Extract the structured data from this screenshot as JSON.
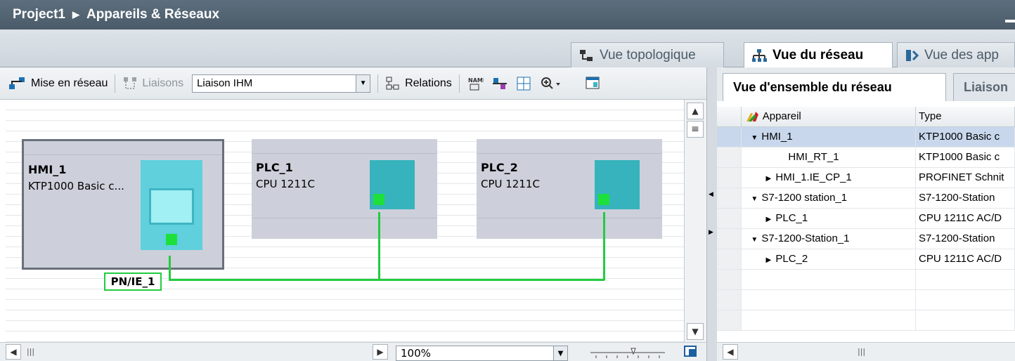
{
  "breadcrumb": {
    "project": "Project1",
    "separator": "▶",
    "section": "Appareils & Réseaux"
  },
  "view_tabs": [
    {
      "label": "Vue topologique",
      "icon": "topology-icon",
      "active": false
    },
    {
      "label": "Vue du réseau",
      "icon": "network-icon",
      "active": true
    },
    {
      "label": "Vue des app",
      "icon": "device-view-icon",
      "active": false
    }
  ],
  "toolbar": {
    "network_label": "Mise en réseau",
    "connections_label": "Liaisons",
    "connection_type": "Liaison IHM",
    "relations_label": "Relations"
  },
  "devices": [
    {
      "name": "HMI_1",
      "model": "KTP1000 Basic c...",
      "selected": true
    },
    {
      "name": "PLC_1",
      "model": "CPU 1211C",
      "selected": false
    },
    {
      "name": "PLC_2",
      "model": "CPU 1211C",
      "selected": false
    }
  ],
  "subnet": {
    "label": "PN/IE_1",
    "color": "#22cc40"
  },
  "zoom": {
    "value": "100%"
  },
  "overview": {
    "tabs": [
      {
        "label": "Vue d'ensemble du réseau",
        "active": true
      },
      {
        "label": "Liaison",
        "active": false
      }
    ],
    "columns": {
      "device": "Appareil",
      "type": "Type"
    },
    "rows": [
      {
        "indent": 1,
        "toggle": "▼",
        "device": "HMI_1",
        "type": "KTP1000 Basic c",
        "selected": true
      },
      {
        "indent": 2,
        "toggle": "",
        "device": "HMI_RT_1",
        "type": "KTP1000 Basic c",
        "selected": false
      },
      {
        "indent": 2,
        "toggle": "▶",
        "device": "HMI_1.IE_CP_1",
        "type": "PROFINET Schnit",
        "selected": false
      },
      {
        "indent": 1,
        "toggle": "▼",
        "device": "S7-1200 station_1",
        "type": "S7-1200-Station",
        "selected": false
      },
      {
        "indent": 2,
        "toggle": "▶",
        "device": "PLC_1",
        "type": "CPU 1211C AC/D",
        "selected": false
      },
      {
        "indent": 1,
        "toggle": "▼",
        "device": "S7-1200-Station_1",
        "type": "S7-1200-Station",
        "selected": false
      },
      {
        "indent": 2,
        "toggle": "▶",
        "device": "PLC_2",
        "type": "CPU 1211C AC/D",
        "selected": false
      }
    ]
  }
}
